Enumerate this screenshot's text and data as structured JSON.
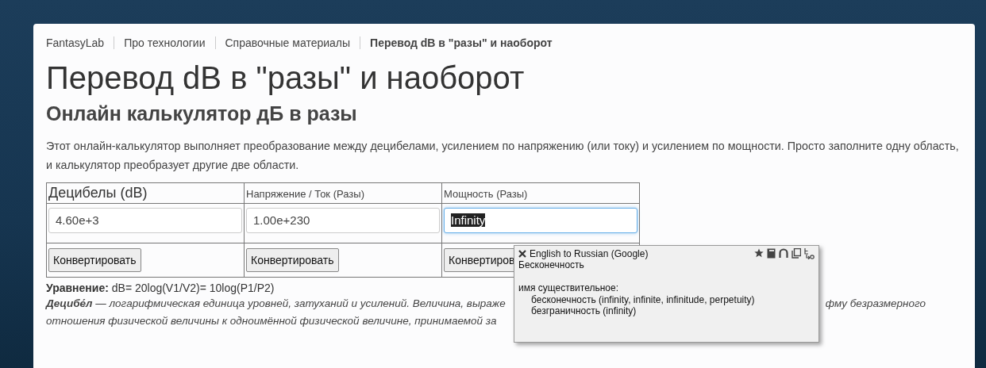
{
  "breadcrumbs": [
    {
      "label": "FantasyLab",
      "current": false
    },
    {
      "label": "Про технологии",
      "current": false
    },
    {
      "label": "Справочные материалы",
      "current": false
    },
    {
      "label": "Перевод dB в \"разы\" и наоборот",
      "current": true
    }
  ],
  "title": "Перевод dB в \"разы\" и наоборот",
  "subtitle": "Онлайн калькулятор дБ в разы",
  "intro": "Этот онлайн-калькулятор выполняет преобразование между децибелами, усилением по напряжению (или току) и усилением по мощности. Просто заполните одну область, и калькулятор преобразует другие две области.",
  "converter": [
    {
      "header": "Децибелы (dB)",
      "header_large": true,
      "value": "4.60e+3",
      "focused": false,
      "text_selected": false,
      "button": "Конвертировать"
    },
    {
      "header": "Напряжение / Ток (Разы)",
      "header_large": false,
      "value": "1.00e+230",
      "focused": false,
      "text_selected": false,
      "button": "Конвертировать"
    },
    {
      "header": "Мощность (Разы)",
      "header_large": false,
      "value": "Infinity",
      "focused": true,
      "text_selected": true,
      "button": "Конвертиров"
    }
  ],
  "equation": {
    "label": "Уравнение:",
    "text": "dB= 20log(V1/V2)= 10log(P1/P2)"
  },
  "definition_lines": [
    {
      "left": "**Децибе́л** — логарифмическая единица уровней, затуханий и усилений. Величина, выраже",
      "right": "фму безразмерного"
    },
    {
      "left": "отношения физической величины к одноимённой физической величине, принимаемой за"
    }
  ],
  "translation_popup": {
    "title": "English to Russian (Google)",
    "translation": "Бесконечность",
    "part_of_speech": "имя существительное:",
    "meanings": [
      "бесконечность (infinity, infinite, infinitude, perpetuity)",
      "безграничность (infinity)"
    ]
  }
}
